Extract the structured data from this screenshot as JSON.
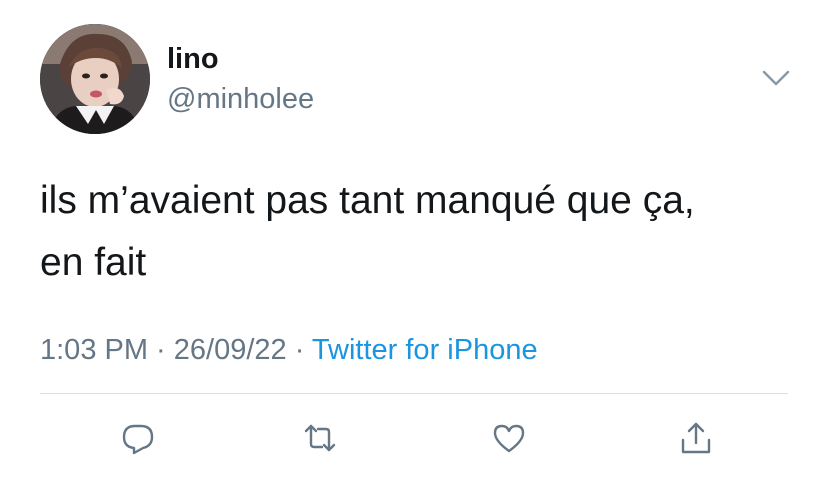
{
  "user": {
    "display_name": "lino",
    "handle": "@minholee",
    "avatar_icon": "profile-photo"
  },
  "tweet": {
    "text_line_1": "ils m’avaient pas tant manqué que ça,",
    "text_line_2": "en fait"
  },
  "meta": {
    "time": "1:03 PM",
    "separator_1": " · ",
    "date": "26/09/22",
    "separator_2": " · ",
    "source": "Twitter for iPhone"
  },
  "actions": [
    {
      "icon": "reply-icon"
    },
    {
      "icon": "retweet-icon"
    },
    {
      "icon": "like-icon"
    },
    {
      "icon": "share-icon"
    }
  ],
  "colors": {
    "text": "#14171a",
    "secondary": "#657786",
    "link": "#1b95e0",
    "divider": "#d9dfe3"
  }
}
